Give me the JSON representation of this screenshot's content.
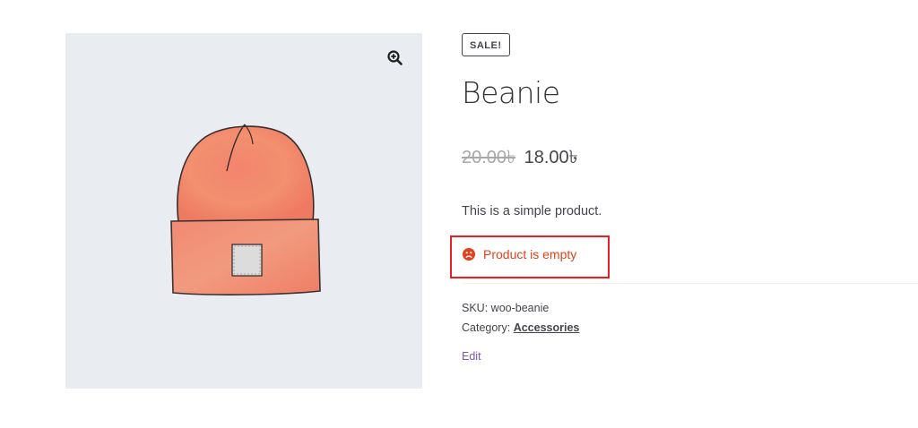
{
  "gallery": {
    "zoom_icon": "zoom-in-icon",
    "image_alt": "Beanie product image",
    "image_icon": "beanie-illustration"
  },
  "product": {
    "sale_badge": "SALE!",
    "title": "Beanie",
    "price_old": "20.00৳",
    "price_new": "18.00৳",
    "short_description": "This is a simple product.",
    "notice": {
      "icon": "frown-face-icon",
      "text": "Product is empty",
      "color": "#e2401c",
      "highlight_border_color": "#ee1d23"
    },
    "meta": {
      "sku_label": "SKU:",
      "sku_value": "woo-beanie",
      "category_label": "Category:",
      "category_value": "Accessories"
    },
    "edit_link": "Edit"
  },
  "colors": {
    "gallery_bg": "#e9ecf0",
    "beanie": "#f28b73",
    "link_purple": "#7f54b3"
  }
}
